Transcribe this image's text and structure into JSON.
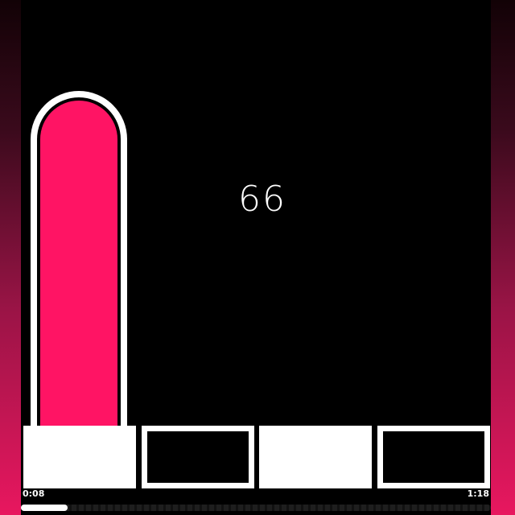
{
  "game": {
    "score": "66",
    "meter_level": 1.0,
    "tiles": [
      {
        "state": "filled"
      },
      {
        "state": "empty"
      },
      {
        "state": "filled"
      },
      {
        "state": "empty"
      }
    ]
  },
  "playback": {
    "elapsed": "0:08",
    "total": "1:18",
    "progress": 0.1
  },
  "colors": {
    "accent": "#ff1464",
    "tile": "#ffffff",
    "background": "#000000"
  }
}
